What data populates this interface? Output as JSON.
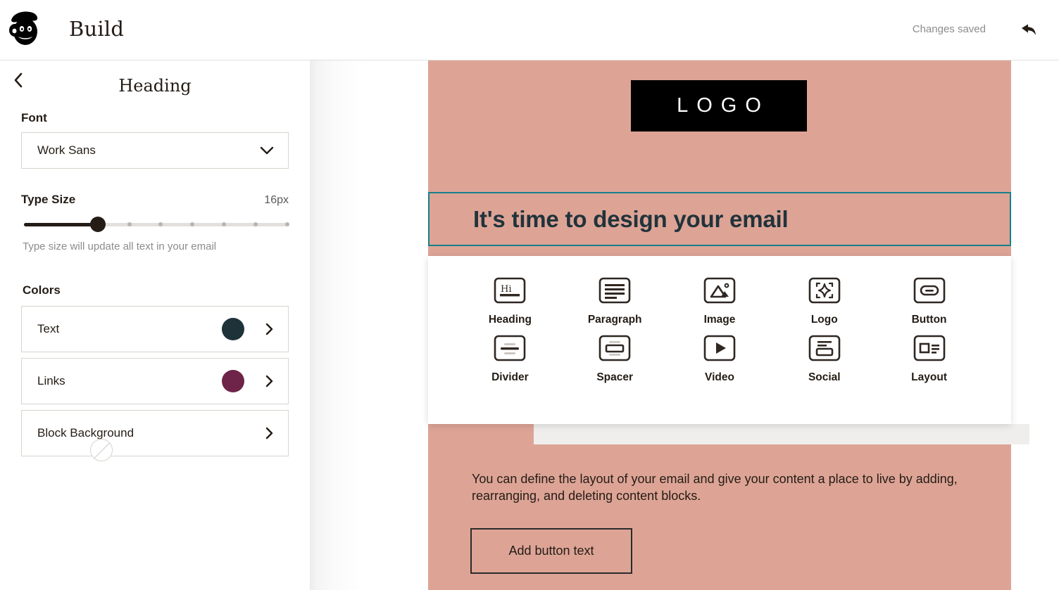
{
  "header": {
    "app_title": "Build",
    "status_text": "Changes saved",
    "logo_icon": "mailchimp-freddie-icon",
    "undo_icon": "undo-arrow-icon"
  },
  "sidebar": {
    "title": "Heading",
    "back_icon": "chevron-left-icon",
    "font": {
      "label": "Font",
      "value": "Work Sans",
      "chevron_icon": "chevron-down-icon"
    },
    "type_size": {
      "label": "Type Size",
      "value": "16px",
      "help": "Type size will update all text in your email",
      "percent": 28
    },
    "colors": {
      "label": "Colors",
      "rows": [
        {
          "label": "Text",
          "swatch": "#1e3239",
          "chevron_icon": "chevron-right-icon"
        },
        {
          "label": "Links",
          "swatch": "#6e2448",
          "chevron_icon": "chevron-right-icon"
        },
        {
          "label": "Block Background",
          "swatch": "none",
          "chevron_icon": "chevron-right-icon"
        }
      ]
    }
  },
  "canvas": {
    "background_color": "#dda496",
    "logo_block": {
      "text": "LOGO",
      "background": "#000000"
    },
    "heading_block": {
      "text": "It's time to design your email",
      "selected": true,
      "selection_color": "#17808d"
    },
    "close_button": {
      "icon": "close-x-icon",
      "color": "#0c7c8c"
    },
    "body_text": "You can define the layout of your email and give your content a place to live by adding, rearranging, and deleting content blocks.",
    "cta_button": {
      "label": "Add button text"
    }
  },
  "block_picker": {
    "rows": [
      [
        {
          "label": "Heading",
          "icon": "heading-block-icon"
        },
        {
          "label": "Paragraph",
          "icon": "paragraph-block-icon"
        },
        {
          "label": "Image",
          "icon": "image-block-icon"
        },
        {
          "label": "Logo",
          "icon": "logo-block-icon"
        },
        {
          "label": "Button",
          "icon": "button-block-icon"
        }
      ],
      [
        {
          "label": "Divider",
          "icon": "divider-block-icon"
        },
        {
          "label": "Spacer",
          "icon": "spacer-block-icon"
        },
        {
          "label": "Video",
          "icon": "video-block-icon"
        },
        {
          "label": "Social",
          "icon": "social-block-icon"
        },
        {
          "label": "Layout",
          "icon": "layout-block-icon"
        }
      ]
    ]
  }
}
